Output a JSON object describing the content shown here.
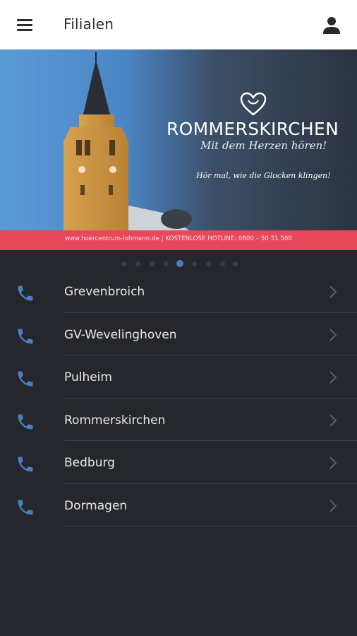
{
  "app_bar": {
    "title": "Filialen",
    "menu_icon": "hamburger-menu-icon",
    "account_icon": "user-icon"
  },
  "banner": {
    "brand": "ROMMERSKIRCHEN",
    "slogan": "Mit dem Herzen hören!",
    "tagline": "Hör mal, wie die Glocken klingen!",
    "footer": "www.hoercentrum-lohmann.de | KOSTENLOSE HOTLINE: 0800 – 50 51 500",
    "logo_icon": "heart-logo-icon",
    "colors": {
      "strip": "#e8485c",
      "sky": "#5a9bd6",
      "dark": "#2c3340"
    }
  },
  "carousel": {
    "count": 9,
    "active_index": 4,
    "active_color": "#4a7fc1"
  },
  "branches": {
    "items": [
      {
        "label": "Grevenbroich"
      },
      {
        "label": "GV-Wevelinghoven"
      },
      {
        "label": "Pulheim"
      },
      {
        "label": "Rommerskirchen"
      },
      {
        "label": "Bedburg"
      },
      {
        "label": "Dormagen"
      }
    ],
    "item_icon": "phone-icon",
    "trailing_icon": "chevron-right-icon",
    "icon_color": "#4a7fc1"
  }
}
